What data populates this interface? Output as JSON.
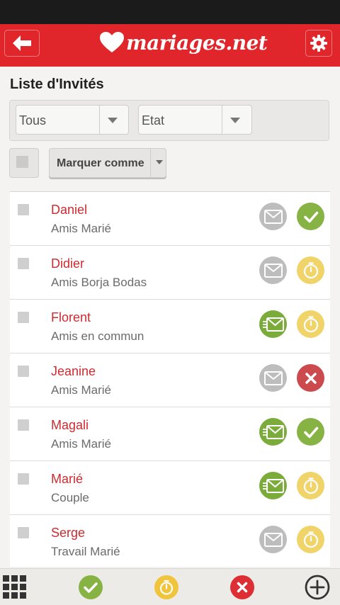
{
  "app": {
    "brand": "mariages.net"
  },
  "header": {
    "title": "Liste d'Invités"
  },
  "filters": {
    "group_select": {
      "value": "Tous"
    },
    "state_select": {
      "value": "Etat"
    }
  },
  "actions": {
    "mark_as_label": "Marquer comme"
  },
  "guests": [
    {
      "name": "Daniel",
      "group": "Amis Marié",
      "invitation": "not-sent",
      "status": "confirmed"
    },
    {
      "name": "Didier",
      "group": "Amis Borja Bodas",
      "invitation": "not-sent",
      "status": "pending"
    },
    {
      "name": "Florent",
      "group": "Amis en commun",
      "invitation": "sent",
      "status": "pending"
    },
    {
      "name": "Jeanine",
      "group": "Amis Marié",
      "invitation": "not-sent",
      "status": "declined"
    },
    {
      "name": "Magali",
      "group": "Amis Marié",
      "invitation": "sent",
      "status": "confirmed"
    },
    {
      "name": "Marié",
      "group": "Couple",
      "invitation": "sent",
      "status": "pending"
    },
    {
      "name": "Serge",
      "group": "Travail Marié",
      "invitation": "not-sent",
      "status": "pending"
    }
  ],
  "bottom_nav": [
    {
      "icon": "grid-icon"
    },
    {
      "icon": "confirmed-filter-icon"
    },
    {
      "icon": "pending-filter-icon"
    },
    {
      "icon": "declined-filter-icon"
    },
    {
      "icon": "add-icon"
    }
  ],
  "colors": {
    "brand_red": "#e0252b",
    "name_red": "#cc2b30",
    "confirmed_green": "#86b344",
    "pending_yellow": "#f0d46a",
    "declined_red": "#cc4a4e",
    "sent_green": "#7aab3b",
    "not_sent_grey": "#bdbdbd"
  }
}
